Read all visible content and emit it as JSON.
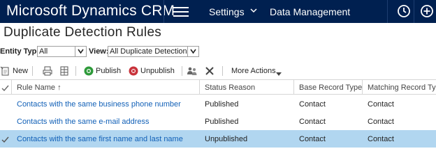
{
  "app": {
    "brand": "Microsoft Dynamics CRM",
    "nav": {
      "area": "Settings",
      "page": "Data Management"
    }
  },
  "page": {
    "title": "Duplicate Detection Rules"
  },
  "filters": {
    "entity_type_label": "Entity Type:",
    "entity_type_value": "All",
    "view_label": "View:",
    "view_value": "All Duplicate Detection Ru"
  },
  "toolbar": {
    "new": "New",
    "publish": "Publish",
    "unpublish": "Unpublish",
    "more_actions": "More Actions"
  },
  "grid": {
    "columns": [
      "Rule Name",
      "Status Reason",
      "Base Record Type",
      "Matching Record Type"
    ],
    "sort_indicator": "↑",
    "rows": [
      {
        "name": "Contacts with the same business phone number",
        "status": "Published",
        "base": "Contact",
        "matching": "Contact",
        "selected": false
      },
      {
        "name": "Contacts with the same e-mail address",
        "status": "Published",
        "base": "Contact",
        "matching": "Contact",
        "selected": false
      },
      {
        "name": "Contacts with the same first name and last name",
        "status": "Unpublished",
        "base": "Contact",
        "matching": "Contact",
        "selected": true
      }
    ]
  },
  "colors": {
    "nav_bg": "#002050",
    "selected_row": "#b1d6f0",
    "link": "#1160b7",
    "publish_green": "#2e9a3a",
    "unpublish_red": "#c8323a"
  },
  "icons": [
    "hamburger-icon",
    "chevron-down-icon",
    "clock-icon",
    "plus-circle-icon",
    "new-record-icon",
    "print-icon",
    "columns-icon",
    "publish-icon",
    "unpublish-icon",
    "assign-icon",
    "delete-icon",
    "check-icon"
  ]
}
